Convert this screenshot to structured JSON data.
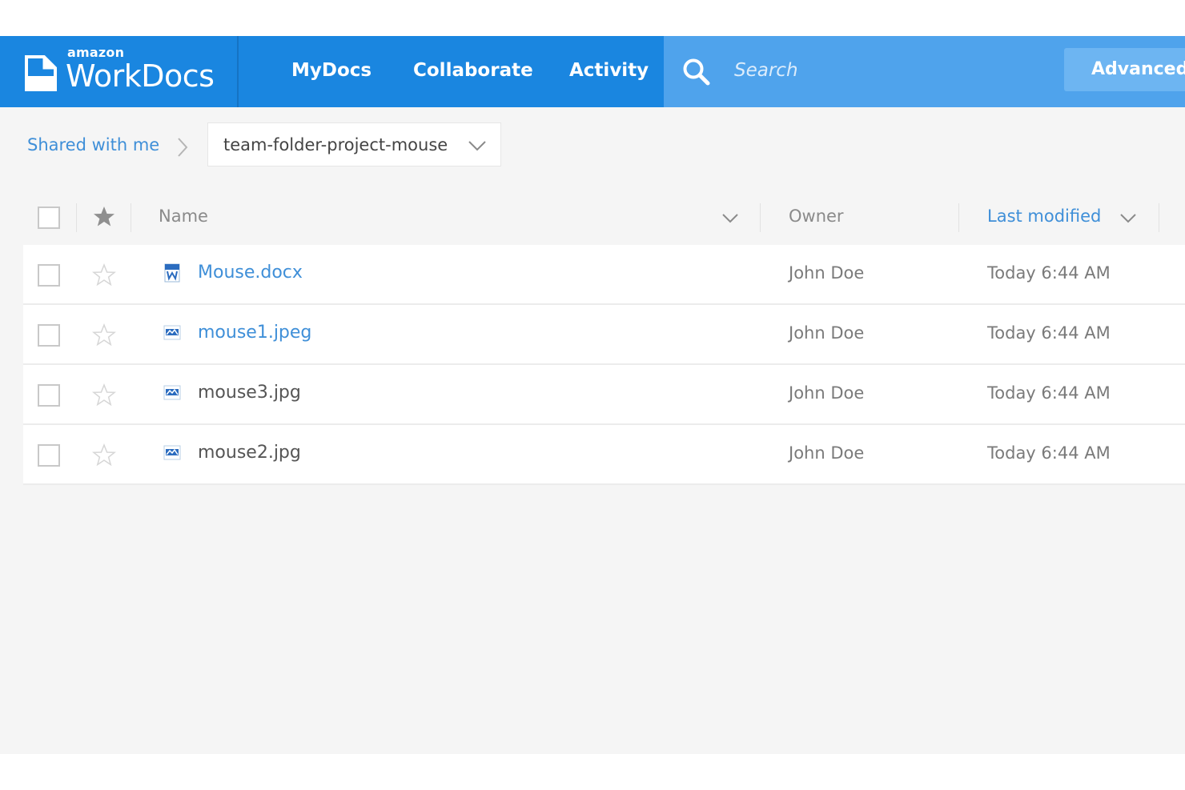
{
  "header": {
    "brand_small": "amazon",
    "brand_name": "WorkDocs",
    "nav": [
      "MyDocs",
      "Collaborate",
      "Activity"
    ],
    "search_placeholder": "Search",
    "advanced_label": "Advanced"
  },
  "breadcrumb": {
    "root": "Shared with me",
    "current_folder": "team-folder-project-mouse"
  },
  "table": {
    "columns": {
      "name": "Name",
      "owner": "Owner",
      "last_modified": "Last modified"
    },
    "rows": [
      {
        "name": "Mouse.docx",
        "owner": "John Doe",
        "modified": "Today 6:44 AM",
        "icon": "word-doc-icon"
      },
      {
        "name": "mouse1.jpeg",
        "owner": "John Doe",
        "modified": "Today 6:44 AM",
        "icon": "image-file-icon"
      },
      {
        "name": "mouse3.jpg",
        "owner": "John Doe",
        "modified": "Today 6:44 AM",
        "icon": "image-file-icon"
      },
      {
        "name": "mouse2.jpg",
        "owner": "John Doe",
        "modified": "Today 6:44 AM",
        "icon": "image-file-icon"
      }
    ]
  },
  "colors": {
    "header_blue": "#1a86e0",
    "search_blue": "#4fa3ec",
    "link_blue": "#3f8fd8"
  }
}
